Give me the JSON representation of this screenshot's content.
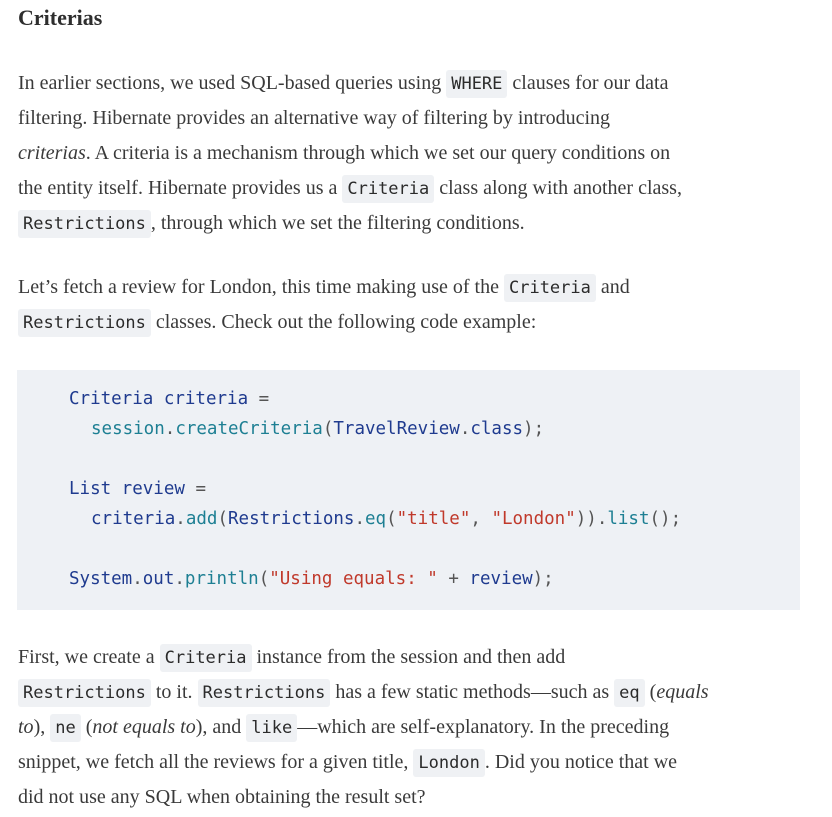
{
  "title": "Criterias",
  "p1": {
    "a": "In earlier sections, we used SQL-based queries using ",
    "c1": "WHERE",
    "b": " clauses for our data",
    "l2": "filtering. Hibernate provides an alternative way of filtering by introducing",
    "em": "criterias",
    "l3": ". A criteria is a mechanism through which we set our query conditions on",
    "l4a": "the entity itself. Hibernate provides us a ",
    "c2": "Criteria",
    "l4b": " class along with another class,",
    "c3": "Restrictions",
    "l5": ", through which we set the filtering conditions."
  },
  "p2": {
    "a": "Let’s fetch a review for London, this time making use of the ",
    "c1": "Criteria",
    "b": " and",
    "c2": "Restrictions",
    "c": " classes. Check out the following code example:"
  },
  "code": {
    "l1a": "Criteria criteria",
    "l1b": " =",
    "l2a": "session",
    "l2b": ".",
    "l2c": "createCriteria",
    "l2d": "(",
    "l2e": "TravelReview",
    "l2f": ".",
    "l2g": "class",
    "l2h": ");",
    "l3a": "List review",
    "l3b": " =",
    "l4a": "criteria",
    "l4b": ".",
    "l4c": "add",
    "l4d": "(",
    "l4e": "Restrictions",
    "l4f": ".",
    "l4g": "eq",
    "l4h": "(",
    "l4i": "\"title\"",
    "l4j": ", ",
    "l4k": "\"London\"",
    "l4l": ")).",
    "l4m": "list",
    "l4n": "();",
    "l5a": "System",
    "l5b": ".",
    "l5c": "out",
    "l5d": ".",
    "l5e": "println",
    "l5f": "(",
    "l5g": "\"Using equals: \"",
    "l5h": " + ",
    "l5i": "review",
    "l5j": ");"
  },
  "p3": {
    "a": "First, we create a ",
    "c1": "Criteria",
    "b": " instance from the session and then add",
    "c2": "Restrictions",
    "c": " to it. ",
    "c3": "Restrictions",
    "d": " has a few static methods—such as ",
    "c4": "eq",
    "e": " (",
    "em1": "equals",
    "em2": "to",
    "f": "), ",
    "c5": "ne",
    "g": " (",
    "em3": "not equals to",
    "h": "), and ",
    "c6": "like",
    "i": "—which are self-explanatory. In the preceding",
    "j": "snippet, we fetch all the reviews for a given title, ",
    "c7": "London",
    "k": ". Did you notice that we",
    "l": "did not use any SQL when obtaining the result set?"
  }
}
